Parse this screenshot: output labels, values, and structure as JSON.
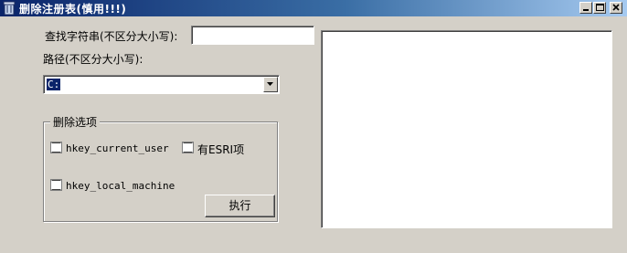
{
  "window": {
    "title": "删除注册表(慎用!!!)"
  },
  "form": {
    "search_label": "查找字符串(不区分大小写):",
    "search_value": "",
    "path_label": "路径(不区分大小写):",
    "path_selected": "C:"
  },
  "options": {
    "group_title": "删除选项",
    "hkcu_label": "hkey_current_user",
    "hkcu_checked": false,
    "esri_label": "有ESRI项",
    "esri_checked": false,
    "hklm_label": "hkey_local_machine",
    "hklm_checked": false
  },
  "actions": {
    "execute_label": "执行"
  },
  "output": {
    "text": ""
  },
  "colors": {
    "title_gradient_start": "#0a246a",
    "title_gradient_end": "#a6caf0",
    "face": "#d4d0c8",
    "selection": "#0a246a"
  }
}
